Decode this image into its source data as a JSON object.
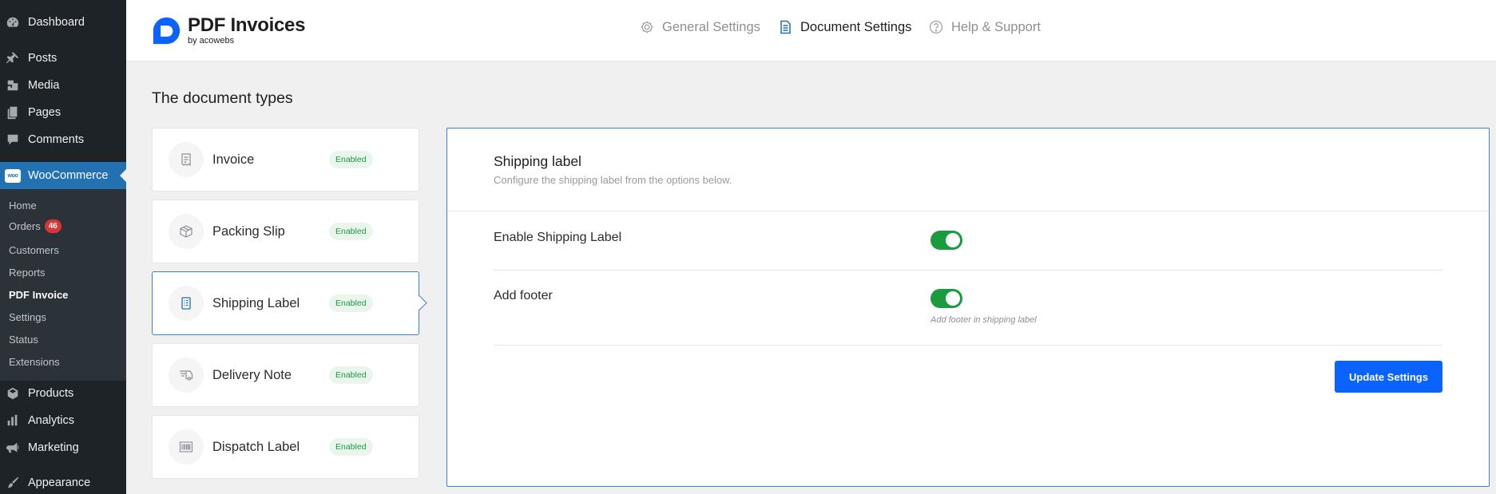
{
  "sidebar": {
    "top_items": [
      {
        "label": "Dashboard",
        "icon": "dashboard-icon"
      },
      {
        "label": "Posts",
        "icon": "pin-icon"
      },
      {
        "label": "Media",
        "icon": "media-icon"
      },
      {
        "label": "Pages",
        "icon": "pages-icon"
      },
      {
        "label": "Comments",
        "icon": "comment-icon"
      }
    ],
    "woocommerce": {
      "label": "WooCommerce",
      "logo_text": "woo"
    },
    "woo_submenu": [
      {
        "label": "Home"
      },
      {
        "label": "Orders",
        "badge": "46"
      },
      {
        "label": "Customers"
      },
      {
        "label": "Reports"
      },
      {
        "label": "PDF Invoice"
      },
      {
        "label": "Settings"
      },
      {
        "label": "Status"
      },
      {
        "label": "Extensions"
      }
    ],
    "bottom_items": [
      {
        "label": "Products",
        "icon": "products-icon"
      },
      {
        "label": "Analytics",
        "icon": "bar-chart-icon"
      },
      {
        "label": "Marketing",
        "icon": "megaphone-icon"
      },
      {
        "label": "Appearance",
        "icon": "paintbrush-icon"
      }
    ]
  },
  "header": {
    "brand_title": "PDF Invoices",
    "brand_subtitle": "by acowebs",
    "tabs": [
      {
        "label": "General Settings",
        "icon": "gear-icon",
        "active": false
      },
      {
        "label": "Document Settings",
        "icon": "document-icon",
        "active": true
      },
      {
        "label": "Help & Support",
        "icon": "question-icon",
        "active": false
      }
    ]
  },
  "main": {
    "section_title": "The document types",
    "documents": [
      {
        "name": "Invoice",
        "status": "Enabled",
        "icon": "invoice-icon"
      },
      {
        "name": "Packing Slip",
        "status": "Enabled",
        "icon": "box-icon"
      },
      {
        "name": "Shipping Label",
        "status": "Enabled",
        "icon": "label-icon",
        "selected": true
      },
      {
        "name": "Delivery Note",
        "status": "Enabled",
        "icon": "delivery-icon"
      },
      {
        "name": "Dispatch Label",
        "status": "Enabled",
        "icon": "barcode-icon"
      }
    ],
    "panel": {
      "title": "Shipping label",
      "description": "Configure the shipping label from the options below.",
      "settings": [
        {
          "label": "Enable Shipping Label",
          "enabled": true
        },
        {
          "label": "Add footer",
          "enabled": true,
          "hint": "Add footer in shipping label"
        }
      ],
      "update_button": "Update Settings"
    }
  },
  "colors": {
    "sidebar_bg": "#1d2327",
    "sidebar_active": "#2271b1",
    "accent_blue": "#0a62ff",
    "toggle_on": "#1a9b3e",
    "badge_red": "#d63638"
  }
}
